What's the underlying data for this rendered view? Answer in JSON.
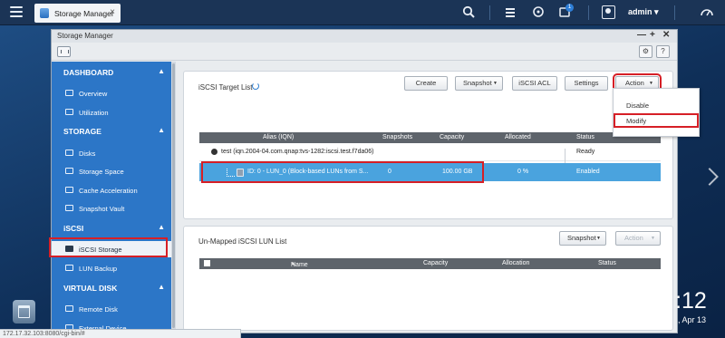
{
  "taskbar": {
    "app_tab_label": "Storage Manager",
    "user": "admin",
    "user_caret": "▾",
    "notif_count": "1",
    "close": "×"
  },
  "window": {
    "title": "Storage Manager",
    "controls": {
      "minimize": "—",
      "maximize": "+",
      "close": "✕"
    }
  },
  "sidebar": {
    "sections": [
      {
        "label": "DASHBOARD",
        "items": [
          "Overview",
          "Utilization"
        ]
      },
      {
        "label": "STORAGE",
        "items": [
          "Disks",
          "Storage Space",
          "Cache Acceleration",
          "Snapshot Vault"
        ]
      },
      {
        "label": "iSCSI",
        "items": [
          "iSCSI Storage",
          "LUN Backup"
        ]
      },
      {
        "label": "VIRTUAL DISK",
        "items": [
          "Remote Disk",
          "External Device"
        ]
      }
    ],
    "caret": "▲",
    "selected": "iSCSI Storage"
  },
  "target_panel": {
    "title": "iSCSI Target List",
    "buttons": {
      "create": "Create",
      "snapshot": "Snapshot",
      "acl": "iSCSI ACL",
      "settings": "Settings",
      "action": "Action"
    },
    "dropdown_glyph": "▼",
    "columns": [
      "Alias (IQN)",
      "Snapshots",
      "Capacity",
      "Allocated",
      "Status"
    ],
    "target_row": {
      "alias": "test (iqn.2004-04.com.qnap:tvs-1282:iscsi.test.f7da06)",
      "status": "Ready"
    },
    "lun_row": {
      "alias": "ID: 0 - LUN_0 (Block-based LUNs from S...",
      "snapshots": "0",
      "capacity": "100.00 GB",
      "allocated": "0 %",
      "status": "Enabled"
    }
  },
  "action_menu": {
    "items": [
      "Disable",
      "Modify"
    ]
  },
  "lun_panel": {
    "title": "Un-Mapped iSCSI LUN List",
    "buttons": {
      "snapshot": "Snapshot",
      "action": "Action"
    },
    "columns": [
      "Name",
      "Capacity",
      "Allocation",
      "Status"
    ],
    "sort_glyph": "▲"
  },
  "statusbar": {
    "url": "172.17.32.103:8080/cgi-bin/#"
  },
  "desktop": {
    "clock": ":12",
    "date": ", Apr 13"
  }
}
